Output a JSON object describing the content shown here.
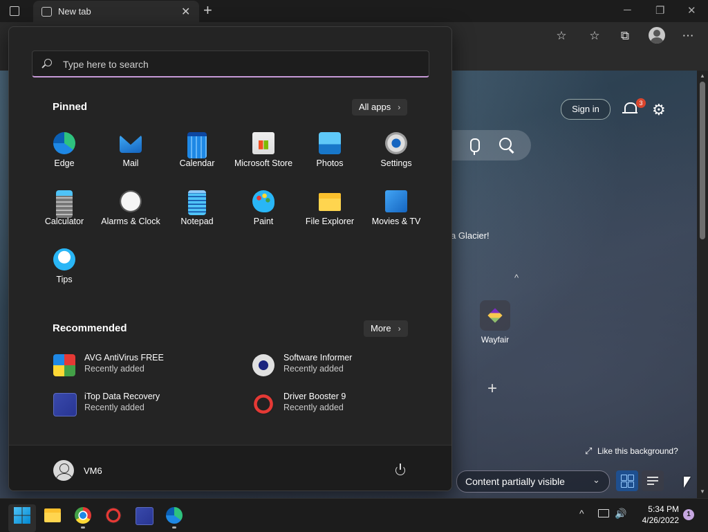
{
  "browser": {
    "tab_title": "New tab",
    "tab_close": "✕",
    "new_tab": "+",
    "minimize": "─",
    "restore": "❐",
    "close": "✕",
    "toolbar": {
      "add_favorite": "☆",
      "favorites": "☆",
      "collections": "⧉",
      "more": "⋯"
    }
  },
  "newtab_page": {
    "sign_in": "Sign in",
    "notification_count": "3",
    "settings_glyph": "⚙",
    "image_title": "a Glacier!",
    "collapse_glyph": "^",
    "quick_links": [
      {
        "label": "Wayfair"
      }
    ],
    "add_site_glyph": "+",
    "like_background": "Like this background?",
    "expand_glyph": "⤢",
    "content_visibility": "Content partially visible",
    "chevron_down": "⌄"
  },
  "start_menu": {
    "search_placeholder": "Type here to search",
    "pinned_title": "Pinned",
    "all_apps_label": "All apps",
    "recommended_title": "Recommended",
    "more_label": "More",
    "chevron": "›",
    "pinned_apps": [
      {
        "label": "Edge",
        "icon": "edge-icon"
      },
      {
        "label": "Mail",
        "icon": "mail-icon"
      },
      {
        "label": "Calendar",
        "icon": "calendar-icon"
      },
      {
        "label": "Microsoft Store",
        "icon": "store-icon"
      },
      {
        "label": "Photos",
        "icon": "photos-icon"
      },
      {
        "label": "Settings",
        "icon": "gear-icon"
      },
      {
        "label": "Calculator",
        "icon": "calculator-icon"
      },
      {
        "label": "Alarms & Clock",
        "icon": "clock-icon"
      },
      {
        "label": "Notepad",
        "icon": "notepad-icon"
      },
      {
        "label": "Paint",
        "icon": "paint-icon"
      },
      {
        "label": "File Explorer",
        "icon": "folder-icon"
      },
      {
        "label": "Movies & TV",
        "icon": "movies-icon"
      },
      {
        "label": "Tips",
        "icon": "tips-icon"
      }
    ],
    "recommended": [
      {
        "name": "AVG AntiVirus FREE",
        "sub": "Recently added"
      },
      {
        "name": "Software Informer",
        "sub": "Recently added"
      },
      {
        "name": "iTop Data Recovery",
        "sub": "Recently added"
      },
      {
        "name": "Driver Booster 9",
        "sub": "Recently added"
      }
    ],
    "user_name": "VM6"
  },
  "taskbar": {
    "tray_chevron": "^",
    "volume_glyph": "🔊",
    "time": "5:34 PM",
    "date": "4/26/2022",
    "notification_count": "1"
  },
  "colors": {
    "accent": "#c79ad8",
    "start_bg": "#242424",
    "taskbar_bg": "#1c1c1c"
  }
}
